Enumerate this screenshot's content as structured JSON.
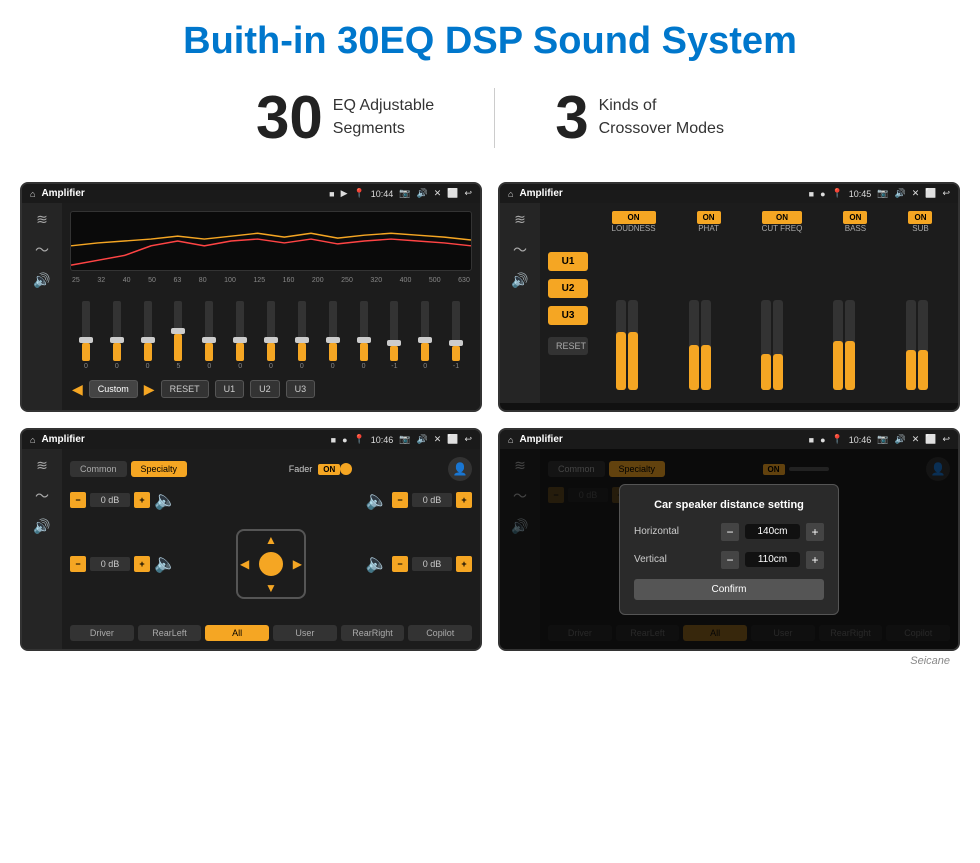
{
  "page": {
    "title": "Buith-in 30EQ DSP Sound System"
  },
  "stats": [
    {
      "number": "30",
      "text_line1": "EQ Adjustable",
      "text_line2": "Segments"
    },
    {
      "number": "3",
      "text_line1": "Kinds of",
      "text_line2": "Crossover Modes"
    }
  ],
  "screen1": {
    "status": {
      "app": "Amplifier",
      "time": "10:44"
    },
    "eq_labels": [
      "25",
      "32",
      "40",
      "50",
      "63",
      "80",
      "100",
      "125",
      "160",
      "200",
      "250",
      "320",
      "400",
      "500",
      "630"
    ],
    "eq_values": [
      "0",
      "0",
      "0",
      "5",
      "0",
      "0",
      "0",
      "0",
      "0",
      "0",
      "-1",
      "0",
      "-1"
    ],
    "bottom": {
      "preset": "Custom",
      "buttons": [
        "RESET",
        "U1",
        "U2",
        "U3"
      ]
    }
  },
  "screen2": {
    "status": {
      "app": "Amplifier",
      "time": "10:45"
    },
    "u_buttons": [
      "U1",
      "U2",
      "U3"
    ],
    "bands": [
      {
        "on": true,
        "label": "LOUDNESS"
      },
      {
        "on": true,
        "label": "PHAT"
      },
      {
        "on": true,
        "label": "CUT FREQ"
      },
      {
        "on": true,
        "label": "BASS"
      },
      {
        "on": true,
        "label": "SUB"
      }
    ],
    "reset_label": "RESET"
  },
  "screen3": {
    "status": {
      "app": "Amplifier",
      "time": "10:46"
    },
    "tabs": [
      "Common",
      "Specialty"
    ],
    "active_tab": "Specialty",
    "fader_label": "Fader",
    "fader_on": "ON",
    "db_values": [
      "0 dB",
      "0 dB",
      "0 dB",
      "0 dB"
    ],
    "footer_buttons": [
      "Driver",
      "RearLeft",
      "All",
      "User",
      "RearRight",
      "Copilot"
    ]
  },
  "screen4": {
    "status": {
      "app": "Amplifier",
      "time": "10:46"
    },
    "tabs": [
      "Common",
      "Specialty"
    ],
    "dialog": {
      "title": "Car speaker distance setting",
      "horizontal_label": "Horizontal",
      "horizontal_value": "140cm",
      "vertical_label": "Vertical",
      "vertical_value": "110cm",
      "confirm_label": "Confirm"
    },
    "footer_buttons": [
      "Driver",
      "RearLeft",
      "User",
      "RearRight",
      "Copilot"
    ]
  },
  "watermark": "Seicane",
  "icons": {
    "home": "⌂",
    "back": "↩",
    "play": "▶",
    "prev": "◀",
    "speaker": "🔊",
    "eq_icon": "≋",
    "person": "👤",
    "up_arrow": "▲",
    "down_arrow": "▼",
    "left_arrow": "◀",
    "right_arrow": "▶"
  }
}
